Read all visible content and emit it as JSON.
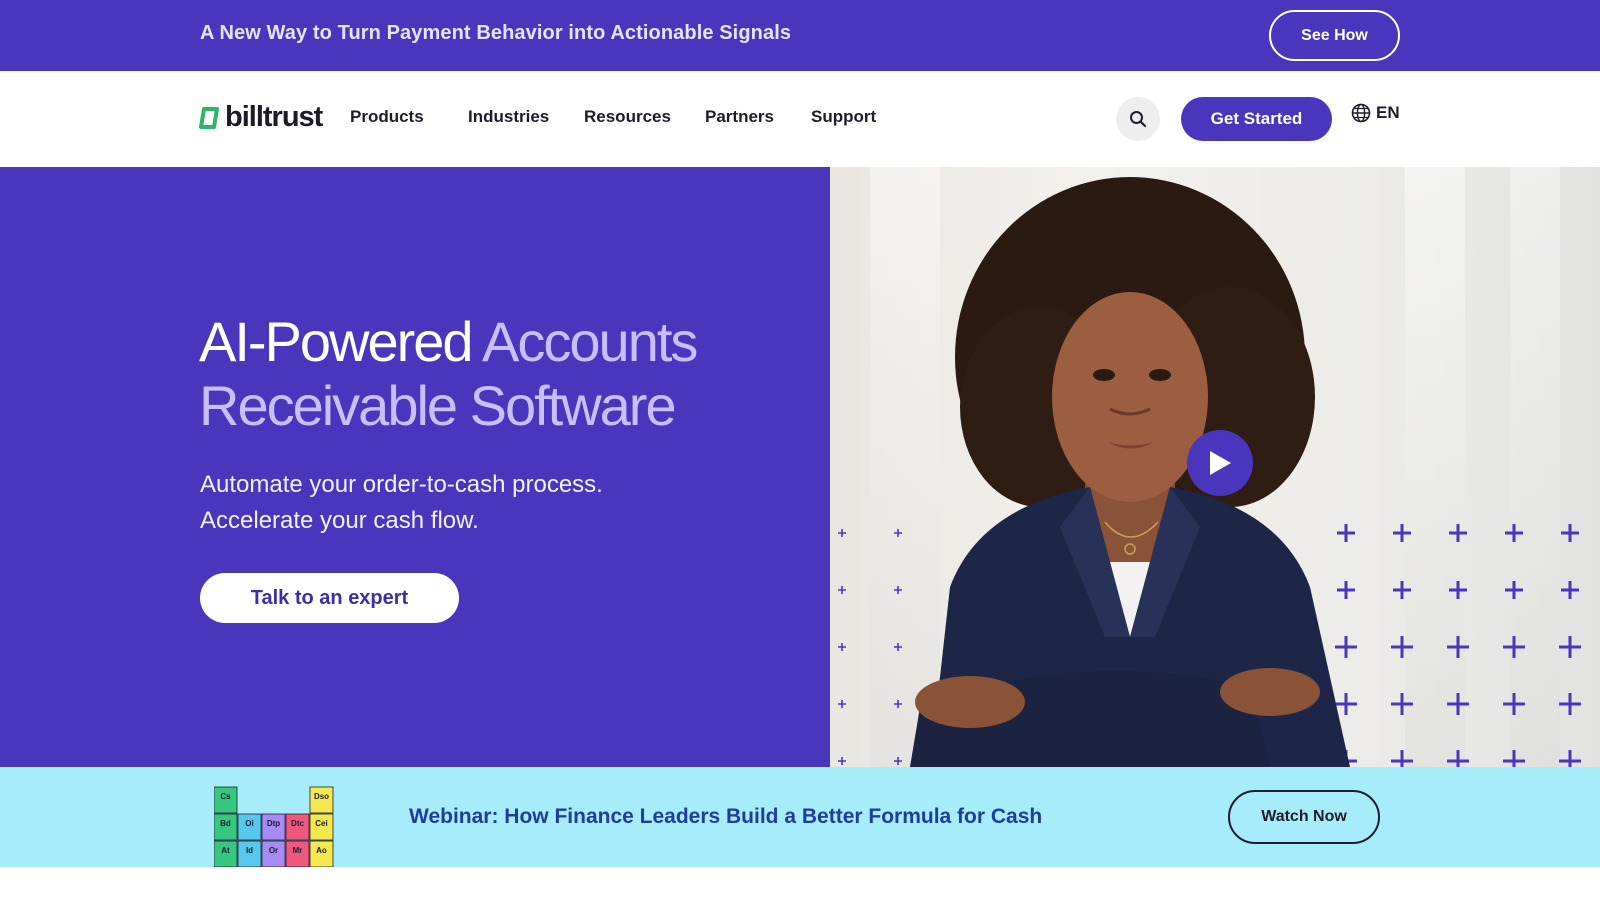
{
  "announcement": {
    "text": "A New Way to Turn Payment Behavior into Actionable Signals",
    "button_label": "See How"
  },
  "nav": {
    "logo_text": "billtrust",
    "links": [
      "Products",
      "Industries",
      "Resources",
      "Partners",
      "Support"
    ],
    "search_icon": "search-icon",
    "cta_label": "Get Started",
    "language_label": "EN",
    "language_icon": "globe-icon"
  },
  "hero": {
    "title_white": "AI-Powered",
    "title_light_1": "Accounts",
    "title_light_2": "Receivable Software",
    "subtitle_line1": "Automate your order-to-cash process.",
    "subtitle_line2": "Accelerate your cash flow.",
    "cta_label": "Talk to an expert",
    "play_icon": "play-icon"
  },
  "webinar": {
    "text": "Webinar: How Finance Leaders Build a Better Formula for Cash",
    "button_label": "Watch Now",
    "table_cells": [
      {
        "sym": "Cs",
        "color": "#36c780"
      },
      {
        "sym": "Bd",
        "color": "#36c780"
      },
      {
        "sym": "At",
        "color": "#36c780"
      },
      {
        "sym": "Oi",
        "color": "#56c8ee"
      },
      {
        "sym": "Id",
        "color": "#56c8ee"
      },
      {
        "sym": "Dtp",
        "color": "#a78bf4"
      },
      {
        "sym": "Or",
        "color": "#a78bf4"
      },
      {
        "sym": "Dtc",
        "color": "#f0577e"
      },
      {
        "sym": "Mr",
        "color": "#f0577e"
      },
      {
        "sym": "Dso",
        "color": "#f4e84f"
      },
      {
        "sym": "Cei",
        "color": "#f4e84f"
      },
      {
        "sym": "Ao",
        "color": "#f4e84f"
      }
    ]
  },
  "colors": {
    "brand_purple": "#4a35bd",
    "hero_light": "#c9befb",
    "webinar_bg": "#a6ecfb",
    "webinar_text": "#1c3e9e",
    "logo_green": "#2fb36a"
  }
}
